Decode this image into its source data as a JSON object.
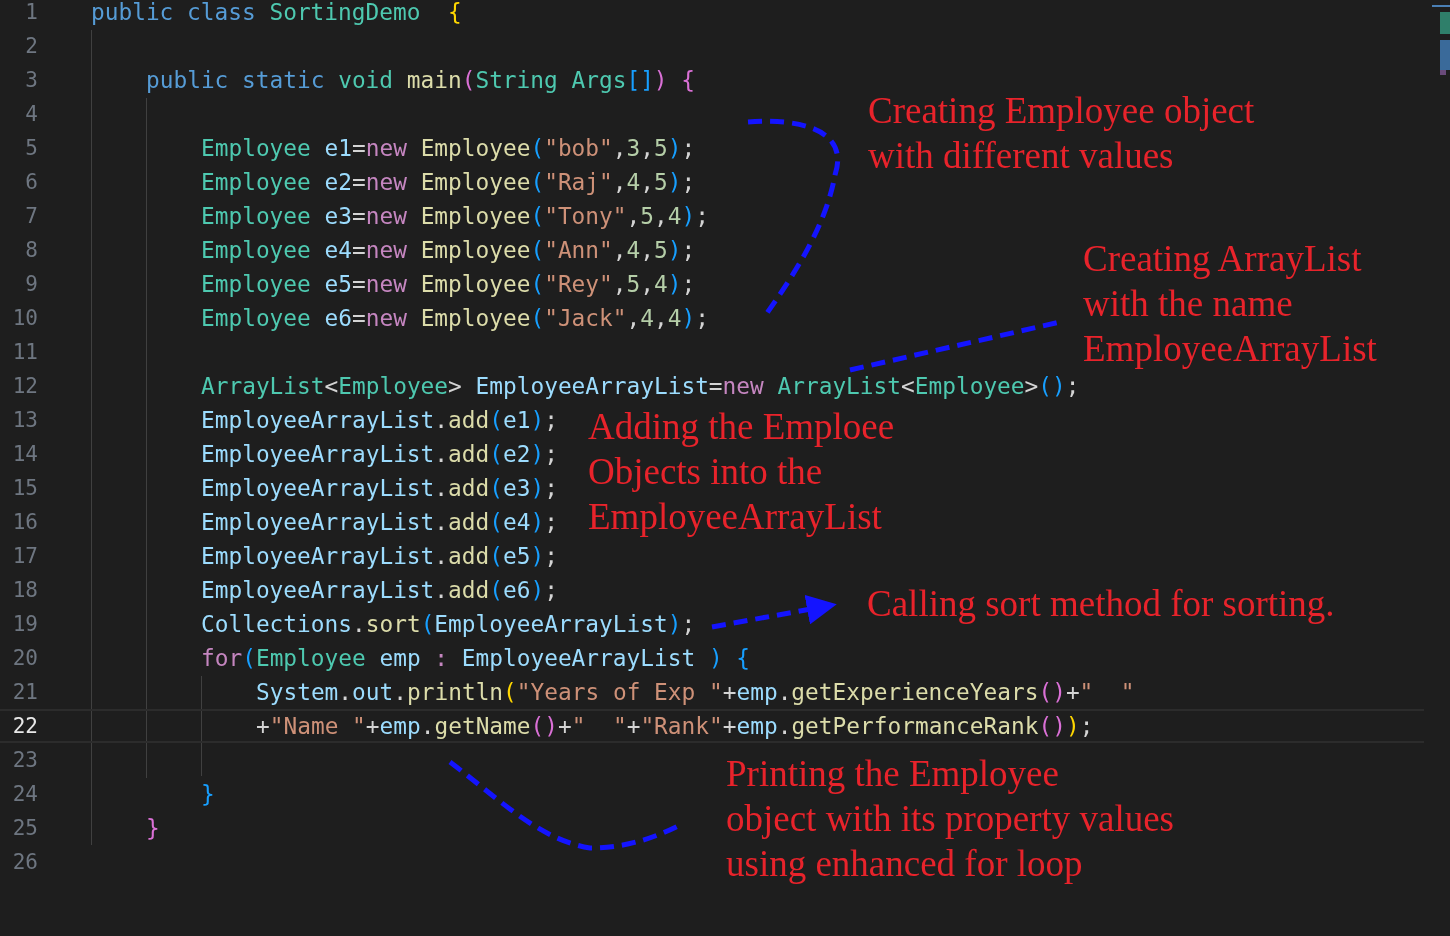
{
  "editor": {
    "lines": [
      {
        "number": "1",
        "current": false,
        "kind": "top",
        "tokens": [
          {
            "kind": "keyword",
            "text": "public class "
          },
          {
            "kind": "type",
            "text": "SortingDemo  "
          },
          {
            "kind": "brace1",
            "text": "{"
          }
        ]
      },
      {
        "number": "2",
        "current": false
      },
      {
        "number": "3",
        "current": false,
        "kind": "member",
        "tokens": [
          {
            "kind": "keyword",
            "text": "public static "
          },
          {
            "kind": "type",
            "text": "void "
          },
          {
            "kind": "func",
            "text": "main"
          },
          {
            "kind": "brace2",
            "text": "("
          },
          {
            "kind": "type",
            "text": "String Args"
          },
          {
            "kind": "brace3",
            "text": "[]"
          },
          {
            "kind": "brace2",
            "text": ") "
          },
          {
            "kind": "brace2",
            "text": "{"
          }
        ]
      },
      {
        "number": "4",
        "current": false
      },
      {
        "number": "5",
        "current": false,
        "kind": "body",
        "tokens": [
          {
            "kind": "type",
            "text": "Employee "
          },
          {
            "kind": "var",
            "text": "e1"
          },
          {
            "kind": "plain",
            "text": "="
          },
          {
            "kind": "control",
            "text": "new "
          },
          {
            "kind": "func",
            "text": "Employee"
          },
          {
            "kind": "brace3",
            "text": "("
          },
          {
            "kind": "string",
            "text": "\"bob\""
          },
          {
            "kind": "plain",
            "text": ","
          },
          {
            "kind": "number",
            "text": "3"
          },
          {
            "kind": "plain",
            "text": ","
          },
          {
            "kind": "number",
            "text": "5"
          },
          {
            "kind": "brace3",
            "text": ")"
          },
          {
            "kind": "plain",
            "text": ";"
          }
        ]
      },
      {
        "number": "6",
        "current": false,
        "kind": "body",
        "tokens": [
          {
            "kind": "type",
            "text": "Employee "
          },
          {
            "kind": "var",
            "text": "e2"
          },
          {
            "kind": "plain",
            "text": "="
          },
          {
            "kind": "control",
            "text": "new "
          },
          {
            "kind": "func",
            "text": "Employee"
          },
          {
            "kind": "brace3",
            "text": "("
          },
          {
            "kind": "string",
            "text": "\"Raj\""
          },
          {
            "kind": "plain",
            "text": ","
          },
          {
            "kind": "number",
            "text": "4"
          },
          {
            "kind": "plain",
            "text": ","
          },
          {
            "kind": "number",
            "text": "5"
          },
          {
            "kind": "brace3",
            "text": ")"
          },
          {
            "kind": "plain",
            "text": ";"
          }
        ]
      },
      {
        "number": "7",
        "current": false,
        "kind": "body",
        "tokens": [
          {
            "kind": "type",
            "text": "Employee "
          },
          {
            "kind": "var",
            "text": "e3"
          },
          {
            "kind": "plain",
            "text": "="
          },
          {
            "kind": "control",
            "text": "new "
          },
          {
            "kind": "func",
            "text": "Employee"
          },
          {
            "kind": "brace3",
            "text": "("
          },
          {
            "kind": "string",
            "text": "\"Tony\""
          },
          {
            "kind": "plain",
            "text": ","
          },
          {
            "kind": "number",
            "text": "5"
          },
          {
            "kind": "plain",
            "text": ","
          },
          {
            "kind": "number",
            "text": "4"
          },
          {
            "kind": "brace3",
            "text": ")"
          },
          {
            "kind": "plain",
            "text": ";"
          }
        ]
      },
      {
        "number": "8",
        "current": false,
        "kind": "body",
        "tokens": [
          {
            "kind": "type",
            "text": "Employee "
          },
          {
            "kind": "var",
            "text": "e4"
          },
          {
            "kind": "plain",
            "text": "="
          },
          {
            "kind": "control",
            "text": "new "
          },
          {
            "kind": "func",
            "text": "Employee"
          },
          {
            "kind": "brace3",
            "text": "("
          },
          {
            "kind": "string",
            "text": "\"Ann\""
          },
          {
            "kind": "plain",
            "text": ","
          },
          {
            "kind": "number",
            "text": "4"
          },
          {
            "kind": "plain",
            "text": ","
          },
          {
            "kind": "number",
            "text": "5"
          },
          {
            "kind": "brace3",
            "text": ")"
          },
          {
            "kind": "plain",
            "text": ";"
          }
        ]
      },
      {
        "number": "9",
        "current": false,
        "kind": "body",
        "tokens": [
          {
            "kind": "type",
            "text": "Employee "
          },
          {
            "kind": "var",
            "text": "e5"
          },
          {
            "kind": "plain",
            "text": "="
          },
          {
            "kind": "control",
            "text": "new "
          },
          {
            "kind": "func",
            "text": "Employee"
          },
          {
            "kind": "brace3",
            "text": "("
          },
          {
            "kind": "string",
            "text": "\"Rey\""
          },
          {
            "kind": "plain",
            "text": ","
          },
          {
            "kind": "number",
            "text": "5"
          },
          {
            "kind": "plain",
            "text": ","
          },
          {
            "kind": "number",
            "text": "4"
          },
          {
            "kind": "brace3",
            "text": ")"
          },
          {
            "kind": "plain",
            "text": ";"
          }
        ]
      },
      {
        "number": "10",
        "current": false,
        "kind": "body",
        "tokens": [
          {
            "kind": "type",
            "text": "Employee "
          },
          {
            "kind": "var",
            "text": "e6"
          },
          {
            "kind": "plain",
            "text": "="
          },
          {
            "kind": "control",
            "text": "new "
          },
          {
            "kind": "func",
            "text": "Employee"
          },
          {
            "kind": "brace3",
            "text": "("
          },
          {
            "kind": "string",
            "text": "\"Jack\""
          },
          {
            "kind": "plain",
            "text": ","
          },
          {
            "kind": "number",
            "text": "4"
          },
          {
            "kind": "plain",
            "text": ","
          },
          {
            "kind": "number",
            "text": "4"
          },
          {
            "kind": "brace3",
            "text": ")"
          },
          {
            "kind": "plain",
            "text": ";"
          }
        ]
      },
      {
        "number": "11",
        "current": false
      },
      {
        "number": "12",
        "current": false,
        "kind": "body",
        "tokens": [
          {
            "kind": "type",
            "text": "ArrayList"
          },
          {
            "kind": "plain",
            "text": "<"
          },
          {
            "kind": "type",
            "text": "Employee"
          },
          {
            "kind": "plain",
            "text": "> "
          },
          {
            "kind": "var",
            "text": "EmployeeArrayList"
          },
          {
            "kind": "plain",
            "text": "="
          },
          {
            "kind": "control",
            "text": "new "
          },
          {
            "kind": "type",
            "text": "ArrayList"
          },
          {
            "kind": "plain",
            "text": "<"
          },
          {
            "kind": "type",
            "text": "Employee"
          },
          {
            "kind": "plain",
            "text": ">"
          },
          {
            "kind": "brace3",
            "text": "()"
          },
          {
            "kind": "plain",
            "text": ";"
          }
        ]
      },
      {
        "number": "13",
        "current": false,
        "kind": "body",
        "tokens": [
          {
            "kind": "var",
            "text": "EmployeeArrayList"
          },
          {
            "kind": "plain",
            "text": "."
          },
          {
            "kind": "func",
            "text": "add"
          },
          {
            "kind": "brace3",
            "text": "("
          },
          {
            "kind": "var",
            "text": "e1"
          },
          {
            "kind": "brace3",
            "text": ")"
          },
          {
            "kind": "plain",
            "text": ";"
          }
        ]
      },
      {
        "number": "14",
        "current": false,
        "kind": "body",
        "tokens": [
          {
            "kind": "var",
            "text": "EmployeeArrayList"
          },
          {
            "kind": "plain",
            "text": "."
          },
          {
            "kind": "func",
            "text": "add"
          },
          {
            "kind": "brace3",
            "text": "("
          },
          {
            "kind": "var",
            "text": "e2"
          },
          {
            "kind": "brace3",
            "text": ")"
          },
          {
            "kind": "plain",
            "text": ";"
          }
        ]
      },
      {
        "number": "15",
        "current": false,
        "kind": "body",
        "tokens": [
          {
            "kind": "var",
            "text": "EmployeeArrayList"
          },
          {
            "kind": "plain",
            "text": "."
          },
          {
            "kind": "func",
            "text": "add"
          },
          {
            "kind": "brace3",
            "text": "("
          },
          {
            "kind": "var",
            "text": "e3"
          },
          {
            "kind": "brace3",
            "text": ")"
          },
          {
            "kind": "plain",
            "text": ";"
          }
        ]
      },
      {
        "number": "16",
        "current": false,
        "kind": "body",
        "tokens": [
          {
            "kind": "var",
            "text": "EmployeeArrayList"
          },
          {
            "kind": "plain",
            "text": "."
          },
          {
            "kind": "func",
            "text": "add"
          },
          {
            "kind": "brace3",
            "text": "("
          },
          {
            "kind": "var",
            "text": "e4"
          },
          {
            "kind": "brace3",
            "text": ")"
          },
          {
            "kind": "plain",
            "text": ";"
          }
        ]
      },
      {
        "number": "17",
        "current": false,
        "kind": "body",
        "tokens": [
          {
            "kind": "var",
            "text": "EmployeeArrayList"
          },
          {
            "kind": "plain",
            "text": "."
          },
          {
            "kind": "func",
            "text": "add"
          },
          {
            "kind": "brace3",
            "text": "("
          },
          {
            "kind": "var",
            "text": "e5"
          },
          {
            "kind": "brace3",
            "text": ")"
          },
          {
            "kind": "plain",
            "text": ";"
          }
        ]
      },
      {
        "number": "18",
        "current": false,
        "kind": "body",
        "tokens": [
          {
            "kind": "var",
            "text": "EmployeeArrayList"
          },
          {
            "kind": "plain",
            "text": "."
          },
          {
            "kind": "func",
            "text": "add"
          },
          {
            "kind": "brace3",
            "text": "("
          },
          {
            "kind": "var",
            "text": "e6"
          },
          {
            "kind": "brace3",
            "text": ")"
          },
          {
            "kind": "plain",
            "text": ";"
          }
        ]
      },
      {
        "number": "19",
        "current": false,
        "kind": "body",
        "tokens": [
          {
            "kind": "var",
            "text": "Collections"
          },
          {
            "kind": "plain",
            "text": "."
          },
          {
            "kind": "func",
            "text": "sort"
          },
          {
            "kind": "brace3",
            "text": "("
          },
          {
            "kind": "var",
            "text": "EmployeeArrayList"
          },
          {
            "kind": "brace3",
            "text": ")"
          },
          {
            "kind": "plain",
            "text": ";"
          }
        ]
      },
      {
        "number": "20",
        "current": false,
        "kind": "body",
        "tokens": [
          {
            "kind": "control",
            "text": "for"
          },
          {
            "kind": "brace3",
            "text": "("
          },
          {
            "kind": "type",
            "text": "Employee "
          },
          {
            "kind": "var",
            "text": "emp "
          },
          {
            "kind": "control",
            "text": ": "
          },
          {
            "kind": "var",
            "text": "EmployeeArrayList "
          },
          {
            "kind": "brace3",
            "text": ") "
          },
          {
            "kind": "brace3",
            "text": "{"
          }
        ]
      },
      {
        "number": "21",
        "current": false,
        "kind": "loop",
        "tokens": [
          {
            "kind": "var",
            "text": "System"
          },
          {
            "kind": "plain",
            "text": "."
          },
          {
            "kind": "var",
            "text": "out"
          },
          {
            "kind": "plain",
            "text": "."
          },
          {
            "kind": "func",
            "text": "println"
          },
          {
            "kind": "brace1",
            "text": "("
          },
          {
            "kind": "string",
            "text": "\"Years of Exp \""
          },
          {
            "kind": "plain",
            "text": "+"
          },
          {
            "kind": "var",
            "text": "emp"
          },
          {
            "kind": "plain",
            "text": "."
          },
          {
            "kind": "func",
            "text": "getExperienceYears"
          },
          {
            "kind": "brace2",
            "text": "()"
          },
          {
            "kind": "plain",
            "text": "+"
          },
          {
            "kind": "string",
            "text": "\"  \""
          }
        ]
      },
      {
        "number": "22",
        "current": true,
        "kind": "loop",
        "tokens": [
          {
            "kind": "plain",
            "text": "+"
          },
          {
            "kind": "string",
            "text": "\"Name \""
          },
          {
            "kind": "plain",
            "text": "+"
          },
          {
            "kind": "var",
            "text": "emp"
          },
          {
            "kind": "plain",
            "text": "."
          },
          {
            "kind": "func",
            "text": "getName"
          },
          {
            "kind": "brace2",
            "text": "()"
          },
          {
            "kind": "plain",
            "text": "+"
          },
          {
            "kind": "string",
            "text": "\"  \""
          },
          {
            "kind": "plain",
            "text": "+"
          },
          {
            "kind": "string",
            "text": "\"Rank\""
          },
          {
            "kind": "plain",
            "text": "+"
          },
          {
            "kind": "var",
            "text": "emp"
          },
          {
            "kind": "plain",
            "text": "."
          },
          {
            "kind": "func",
            "text": "getPerformanceRank"
          },
          {
            "kind": "brace2",
            "text": "()"
          },
          {
            "kind": "brace1",
            "text": ")"
          },
          {
            "kind": "plain",
            "text": ";"
          }
        ]
      },
      {
        "number": "23",
        "current": false
      },
      {
        "number": "24",
        "current": false,
        "kind": "body",
        "tokens": [
          {
            "kind": "brace3",
            "text": "}"
          }
        ]
      },
      {
        "number": "25",
        "current": false,
        "kind": "member",
        "tokens": [
          {
            "kind": "brace2",
            "text": "}"
          }
        ]
      },
      {
        "number": "26",
        "current": false
      }
    ]
  },
  "annotations": [
    {
      "lines": [
        "Creating Employee object",
        "with different values"
      ]
    },
    {
      "lines": [
        "Creating ArrayList",
        "with the name",
        "EmployeeArrayList"
      ]
    },
    {
      "lines": [
        "Adding the Emploee",
        "Objects into the",
        "EmployeeArrayList"
      ]
    },
    {
      "lines": [
        "Calling sort method for sorting."
      ]
    },
    {
      "lines": [
        "Printing the Employee",
        "object with its property values",
        "using enhanced for loop"
      ]
    }
  ]
}
